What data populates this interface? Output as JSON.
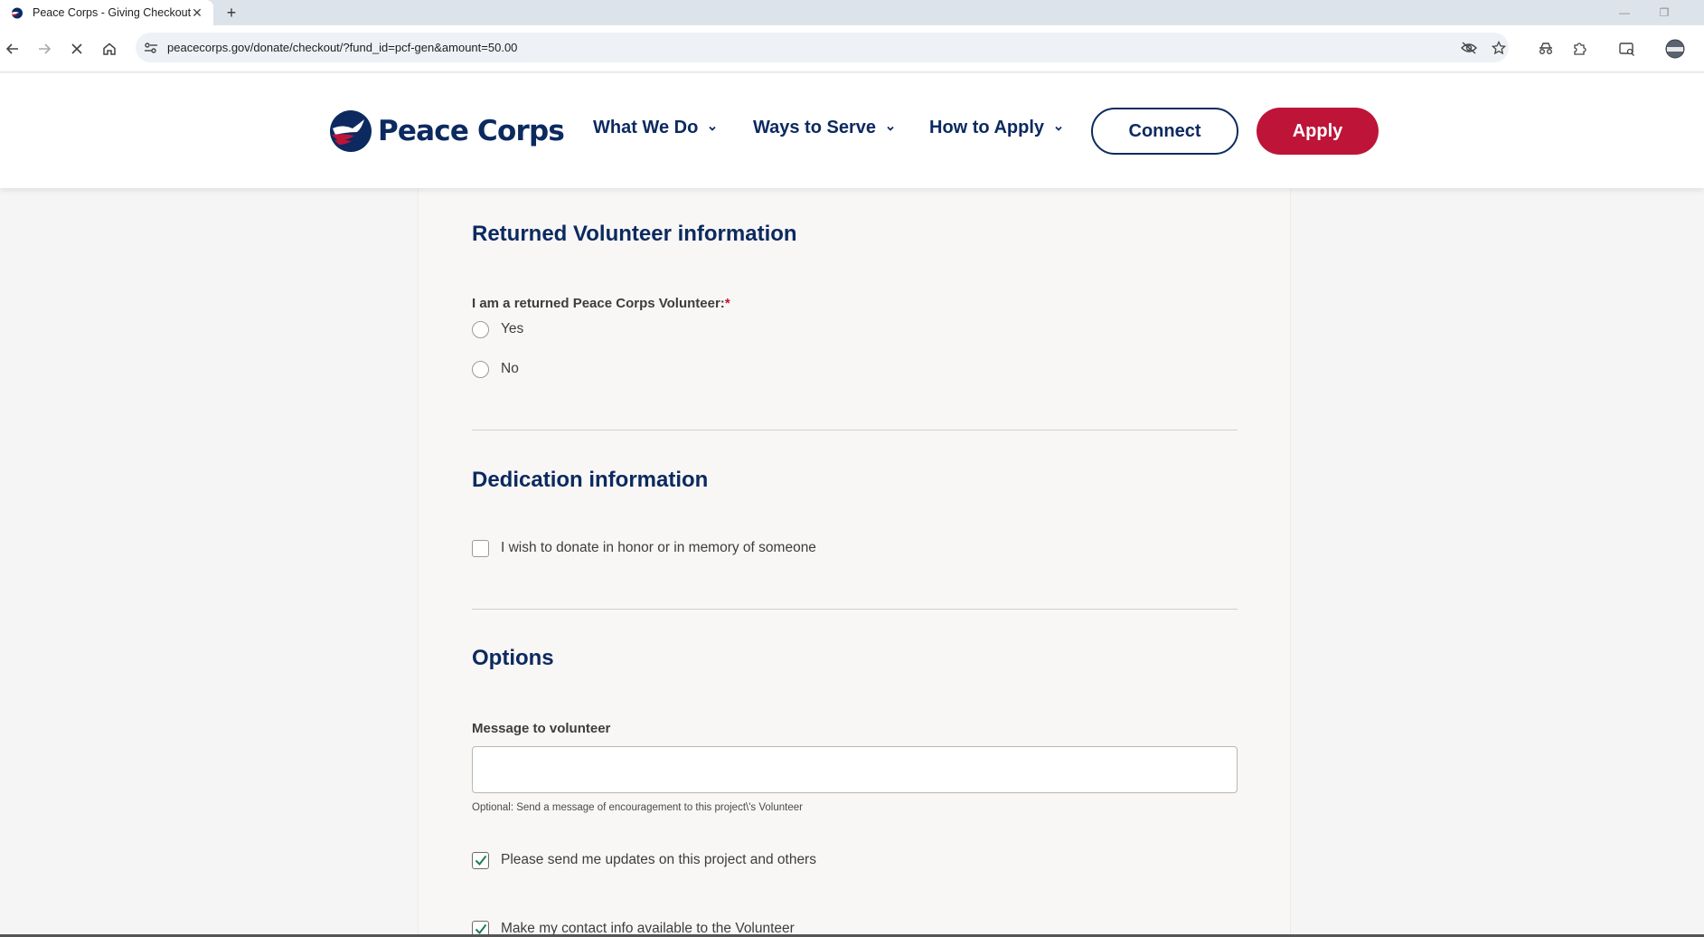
{
  "browser": {
    "tab_title": "Peace Corps - Giving Checkout",
    "url": "peacecorps.gov/donate/checkout/?fund_id=pcf-gen&amount=50.00"
  },
  "header": {
    "logo_text": "Peace Corps",
    "nav": [
      {
        "label": "What We Do"
      },
      {
        "label": "Ways to Serve"
      },
      {
        "label": "How to Apply"
      }
    ],
    "connect_label": "Connect",
    "apply_label": "Apply"
  },
  "returned_volunteer": {
    "title": "Returned Volunteer information",
    "question": "I am a returned Peace Corps Volunteer:",
    "required_mark": "*",
    "options": [
      {
        "label": "Yes",
        "selected": false
      },
      {
        "label": "No",
        "selected": false
      }
    ]
  },
  "dedication": {
    "title": "Dedication information",
    "honor_label": "I wish to donate in honor or in memory of someone",
    "honor_checked": false
  },
  "options": {
    "title": "Options",
    "message_label": "Message to volunteer",
    "message_value": "",
    "message_help": "Optional: Send a message of encouragement to this project\\'s Volunteer",
    "updates_label": "Please send me updates on this project and others",
    "updates_checked": true,
    "contact_label": "Make my contact info available to the Volunteer",
    "contact_checked": true
  },
  "colors": {
    "brand_navy": "#0c2a60",
    "brand_red": "#bd1438",
    "check_green": "#1e7a5a"
  }
}
